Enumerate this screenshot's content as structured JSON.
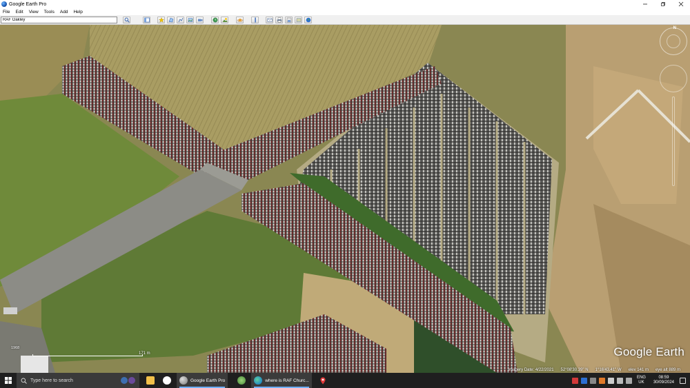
{
  "window": {
    "title": "Google Earth Pro"
  },
  "menu": {
    "items": [
      "File",
      "Edit",
      "View",
      "Tools",
      "Add",
      "Help"
    ]
  },
  "search": {
    "value": "RAF Oakley"
  },
  "map": {
    "brand": "Google Earth",
    "scale_label": "171 m",
    "small_label": "1968",
    "nav_north": "N",
    "status": {
      "imagery_date": "Imagery Date: 4/22/2021",
      "latitude": "52°08'30.39\" N",
      "longitude": "1°16'43.41\" W",
      "elev": "elev  141 m",
      "eye_alt": "eye alt    889 m"
    }
  },
  "taskbar": {
    "search_placeholder": "Type here to search",
    "apps": [
      {
        "label": "Google Earth Pro"
      },
      {
        "label": "where is RAF Churc..."
      }
    ],
    "lang_line1": "ENG",
    "lang_line2": "UK",
    "time": "08:59",
    "date": "30/09/2024"
  }
}
